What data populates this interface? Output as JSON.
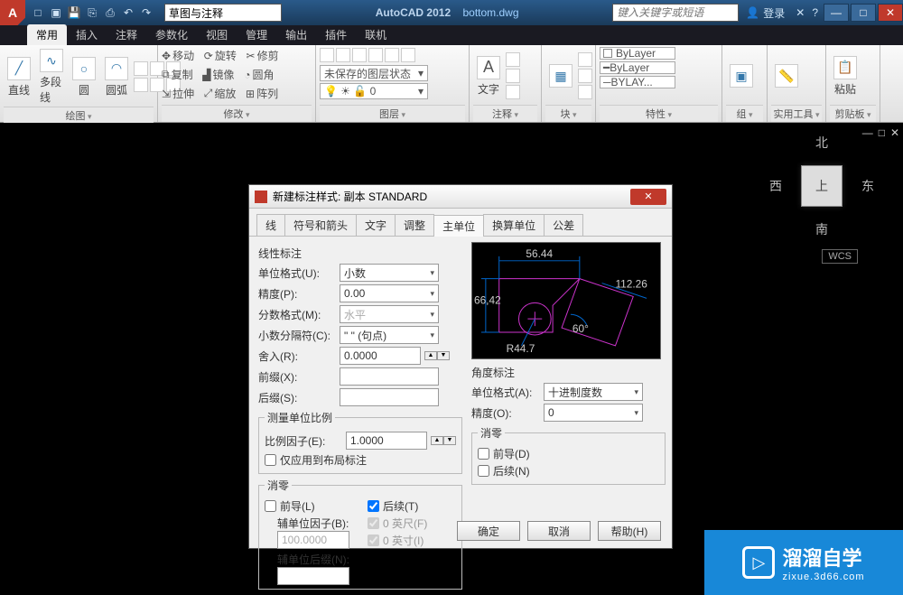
{
  "title": {
    "app": "AutoCAD 2012",
    "file": "bottom.dwg"
  },
  "title_search_value": "草图与注释",
  "title_right_search_placeholder": "键入关键字或短语",
  "login_label": "登录",
  "ribbon_tabs": [
    "常用",
    "插入",
    "注释",
    "参数化",
    "视图",
    "管理",
    "输出",
    "插件",
    "联机"
  ],
  "ribbon_active": 0,
  "ribbon": {
    "draw": {
      "title": "绘图",
      "items": [
        "直线",
        "多段线",
        "圆",
        "圆弧"
      ]
    },
    "modify": {
      "title": "修改",
      "items": [
        "移动",
        "复制",
        "拉伸",
        "旋转",
        "镜像",
        "缩放",
        "修剪",
        "圆角",
        "阵列"
      ]
    },
    "layers": {
      "title": "图层",
      "state": "未保存的图层状态",
      "current": "0"
    },
    "annotate": {
      "title": "注释",
      "item": "文字"
    },
    "block": {
      "title": "块"
    },
    "props": {
      "title": "特性",
      "items": [
        "ByLayer",
        "ByLayer",
        "BYLAY..."
      ]
    },
    "group": {
      "title": "组"
    },
    "util": {
      "title": "实用工具"
    },
    "clip": {
      "title": "剪贴板",
      "item": "粘贴"
    }
  },
  "viewcube": {
    "north": "北",
    "south": "南",
    "east": "东",
    "west": "西",
    "top": "上"
  },
  "wcs": "WCS",
  "dialog": {
    "title": "新建标注样式: 副本 STANDARD",
    "tabs": [
      "线",
      "符号和箭头",
      "文字",
      "调整",
      "主单位",
      "换算单位",
      "公差"
    ],
    "active_tab": 4,
    "left": {
      "section_linear": "线性标注",
      "unit_format_label": "单位格式(U):",
      "unit_format": "小数",
      "precision_label": "精度(P):",
      "precision": "0.00",
      "fraction_label": "分数格式(M):",
      "fraction": "水平",
      "decimal_sep_label": "小数分隔符(C):",
      "decimal_sep": "\" \"  (句点)",
      "round_label": "舍入(R):",
      "round": "0.0000",
      "prefix_label": "前缀(X):",
      "prefix": "",
      "suffix_label": "后缀(S):",
      "suffix": "",
      "scale_group": "测量单位比例",
      "scale_factor_label": "比例因子(E):",
      "scale_factor": "1.0000",
      "layout_only": "仅应用到布局标注",
      "zero_group": "消零",
      "leading": "前导(L)",
      "trailing": "后续(T)",
      "sub_factor_label": "辅单位因子(B):",
      "sub_factor": "100.0000",
      "sub_suffix_label": "辅单位后缀(N):",
      "feet": "0 英尺(F)",
      "inches": "0 英寸(I)"
    },
    "right": {
      "angle_group": "角度标注",
      "unit_format_label": "单位格式(A):",
      "unit_format": "十进制度数",
      "precision_label": "精度(O):",
      "precision": "0",
      "zero_group": "消零",
      "leading": "前导(D)",
      "trailing": "后续(N)"
    },
    "preview": {
      "d1": "56.44",
      "d2": "66,42",
      "d3": "112.26",
      "d4": "R44.7",
      "d5": "60°"
    },
    "buttons": {
      "ok": "确定",
      "cancel": "取消",
      "help": "帮助(H)"
    }
  },
  "watermark": {
    "text": "溜溜自学",
    "sub": "zixue.3d66.com"
  }
}
